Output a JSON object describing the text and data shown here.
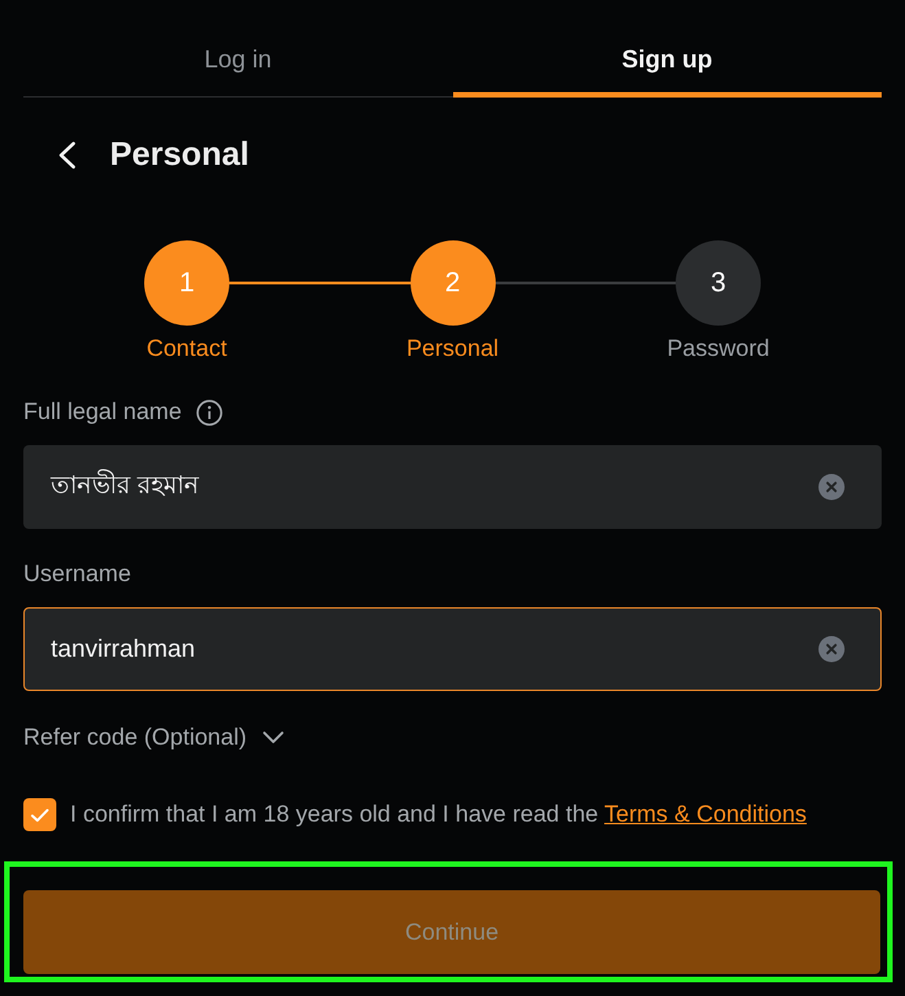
{
  "tabs": [
    {
      "label": "Log in",
      "selected": false
    },
    {
      "label": "Sign up",
      "selected": true
    }
  ],
  "header": {
    "title": "Personal"
  },
  "stepper": {
    "steps": [
      {
        "number": "1",
        "label": "Contact",
        "active": true
      },
      {
        "number": "2",
        "label": "Personal",
        "active": true
      },
      {
        "number": "3",
        "label": "Password",
        "active": false
      }
    ]
  },
  "fields": [
    {
      "label": "Full legal name",
      "info": true,
      "value": "তানভীর রহমান",
      "focused": false
    },
    {
      "label": "Username",
      "info": false,
      "value": "tanvirrahman",
      "focused": true
    }
  ],
  "refer_code": {
    "label": "Refer code (Optional)",
    "expanded": false
  },
  "consent": {
    "checked": true,
    "text": "I confirm that I am 18 years old and I have read the",
    "link": "Terms & Conditions"
  },
  "continue_button": {
    "label": "Continue",
    "disabled": true,
    "highlighted": true
  }
}
